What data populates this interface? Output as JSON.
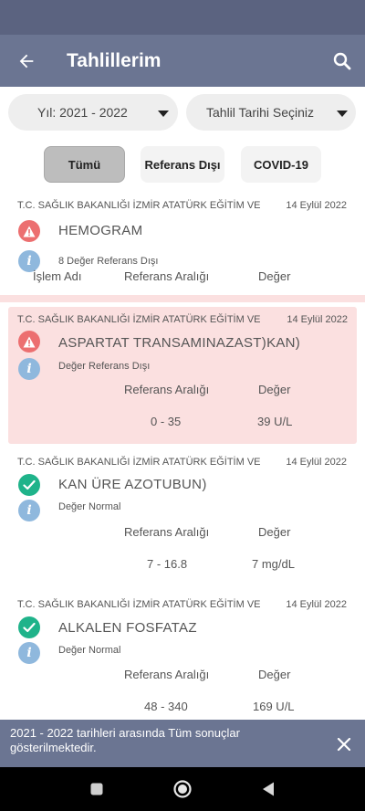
{
  "appbar": {
    "title": "Tahlillerim",
    "back_icon": "arrow-left-icon",
    "search_icon": "search-icon"
  },
  "filters": {
    "year_label": "Yıl: 2021 - 2022",
    "date_label": "Tahlil Tarihi Seçiniz"
  },
  "tabs": [
    {
      "label": "Tümü",
      "active": true
    },
    {
      "label": "Referans Dışı",
      "active": false
    },
    {
      "label": "COVID-19",
      "active": false
    }
  ],
  "tests": [
    {
      "hospital": "T.C. SAĞLIK BAKANLIĞI İZMİR ATATÜRK EĞİTİM VE",
      "date": "14 Eylül 2022",
      "status": "warning",
      "name": "HEMOGRAM",
      "subtext": "8 Değer Referans Dışı",
      "headers": [
        "İşlem Adı",
        "Referans Aralığı",
        "Değer"
      ]
    },
    {
      "hospital": "T.C. SAĞLIK BAKANLIĞI İZMİR ATATÜRK EĞİTİM VE",
      "date": "14 Eylül 2022",
      "status": "warning",
      "name": "ASPARTAT TRANSAMINAZAST)KAN)",
      "subtext": "Değer Referans Dışı",
      "headers": [
        "Referans Aralığı",
        "Değer"
      ],
      "range": "0 - 35",
      "value": "39 U/L"
    },
    {
      "hospital": "T.C. SAĞLIK BAKANLIĞI İZMİR ATATÜRK EĞİTİM VE",
      "date": "14 Eylül 2022",
      "status": "normal",
      "name": "KAN ÜRE AZOTUBUN)",
      "subtext": "Değer Normal",
      "headers": [
        "Referans Aralığı",
        "Değer"
      ],
      "range": "7 - 16.8",
      "value": "7 mg/dL"
    },
    {
      "hospital": "T.C. SAĞLIK BAKANLIĞI İZMİR ATATÜRK EĞİTİM VE",
      "date": "14 Eylül 2022",
      "status": "normal",
      "name": "ALKALEN FOSFATAZ",
      "subtext": "Değer Normal",
      "headers": [
        "Referans Aralığı",
        "Değer"
      ],
      "range": "48 - 340",
      "value": "169 U/L"
    }
  ],
  "info_icon_letter": "i",
  "snackbar": {
    "message": "2021 - 2022 tarihleri arasında Tüm sonuçlar gösterilmektedir.",
    "close_icon": "close-icon"
  },
  "colors": {
    "appbar": "#6b7592",
    "alert_bg": "#fbe0e0",
    "warning": "#ec6f70",
    "ok": "#1fb38a",
    "info": "#8fb8dd"
  }
}
